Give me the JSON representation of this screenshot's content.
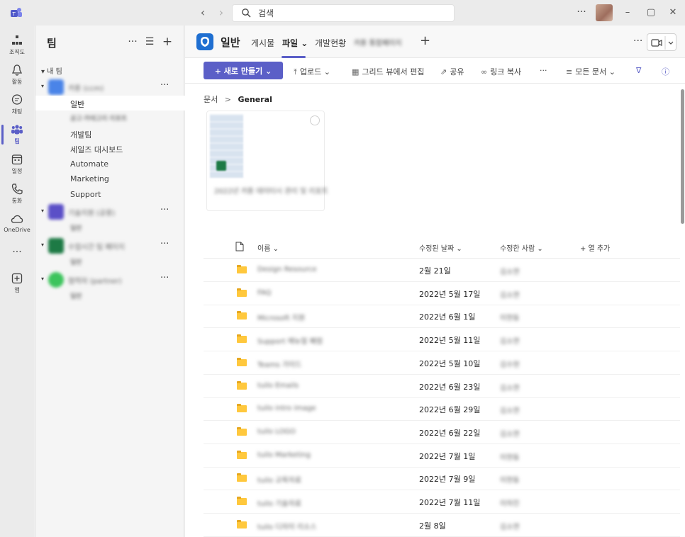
{
  "titlebar": {
    "search_placeholder": "검색",
    "more": "···"
  },
  "rail": [
    {
      "label": "조직도",
      "icon": "org-chart-icon"
    },
    {
      "label": "활동",
      "icon": "bell-icon"
    },
    {
      "label": "채팅",
      "icon": "chat-icon"
    },
    {
      "label": "팀",
      "icon": "teams-icon",
      "active": true
    },
    {
      "label": "일정",
      "icon": "calendar-icon"
    },
    {
      "label": "통화",
      "icon": "phone-icon"
    },
    {
      "label": "OneDrive",
      "icon": "cloud-icon"
    },
    {
      "label": "···",
      "icon": "more-icon"
    },
    {
      "label": "앱",
      "icon": "apps-icon"
    }
  ],
  "teams_panel": {
    "title": "팀",
    "section": "▾ 내 팀",
    "teams": [
      {
        "name": "카툰 (ccm)",
        "avatar_color": "#4a84e8",
        "channels": [
          "일반",
          "공고·카테고리 리포트",
          "개발팀",
          "세일즈 대시보드",
          "Automate",
          "Marketing",
          "Support"
        ],
        "selected_channel": "일반"
      },
      {
        "name": "기술지원 (공용)",
        "avatar_color": "#5b4fc7",
        "channels": [
          "일반"
        ]
      },
      {
        "name": "수업시간 팀 페이지",
        "avatar_color": "#1d7a45",
        "channels": [
          "일반"
        ]
      },
      {
        "name": "협력자 (partner)",
        "avatar_color": "#3cc45c",
        "channels": [
          "일반"
        ]
      }
    ],
    "more": "···"
  },
  "channel_header": {
    "title": "일반",
    "tabs": [
      "게시물",
      "파일 ⌄",
      "개발현황",
      "카툰 통합페이지"
    ],
    "active_tab": "파일 ⌄",
    "add": "+",
    "more": "···"
  },
  "toolbar": {
    "new": "+ 새로 만들기 ⌄",
    "upload": "업로드 ⌄",
    "grid_edit": "그리드 뷰에서 편집",
    "share": "공유",
    "copy_link": "링크 복사",
    "more": "···",
    "all_docs": "모든 문서 ⌄"
  },
  "breadcrumb": {
    "root": "문서",
    "separator": ">",
    "current": "General"
  },
  "tile": {
    "name": "2022년 카툰 데이터시 관리 및 리포트"
  },
  "table": {
    "headers": {
      "name": "이름 ⌄",
      "modified": "수정된 날짜 ⌄",
      "modified_by": "수정한 사람 ⌄",
      "add_column": "+ 열 추가"
    },
    "rows": [
      {
        "name": "Design Resource",
        "modified": "2월 21일",
        "by": "김소연"
      },
      {
        "name": "FAQ",
        "modified": "2022년 5월 17일",
        "by": "김소연"
      },
      {
        "name": "Microsoft 지원",
        "modified": "2022년 6월 1일",
        "by": "이현동"
      },
      {
        "name": "Support 매뉴얼 폐렴",
        "modified": "2022년 5월 11일",
        "by": "김소연"
      },
      {
        "name": "Teams 가이드",
        "modified": "2022년 5월 10일",
        "by": "김수현"
      },
      {
        "name": "tuilo Emails",
        "modified": "2022년 6월 23일",
        "by": "김소연"
      },
      {
        "name": "tuilo intro image",
        "modified": "2022년 6월 29일",
        "by": "김소연"
      },
      {
        "name": "tuilo LOGO",
        "modified": "2022년 6월 22일",
        "by": "김소연"
      },
      {
        "name": "tuilo Marketing",
        "modified": "2022년 7월 1일",
        "by": "이현동"
      },
      {
        "name": "tuilo 교육자료",
        "modified": "2022년 7월 9일",
        "by": "이현동"
      },
      {
        "name": "tuilo 기술자료",
        "modified": "2022년 7월 11일",
        "by": "이하진"
      },
      {
        "name": "tuilo 디자이 리소스",
        "modified": "2월 8일",
        "by": "김소연"
      }
    ]
  }
}
